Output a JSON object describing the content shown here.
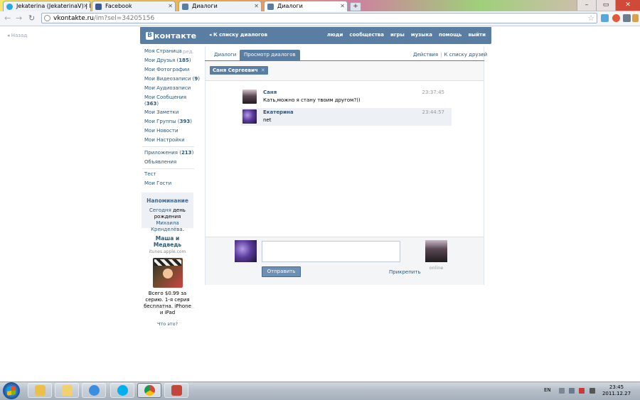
{
  "browser": {
    "tabs": [
      {
        "label": "Jekaterina (JekaterinaV) | Fo",
        "favicon": "skype-icon",
        "active": false
      },
      {
        "label": "Facebook",
        "favicon": "facebook-icon",
        "active": false
      },
      {
        "label": "Диалоги",
        "favicon": "vk-icon",
        "active": false
      },
      {
        "label": "Диалоги",
        "favicon": "vk-icon",
        "active": true
      }
    ],
    "url_host": "vkontakte.ru",
    "url_path": "/im?sel=34205156"
  },
  "vk": {
    "back_label": "Назад",
    "logo": {
      "letter": "B",
      "word": "контакте"
    },
    "to_list_label": "◂ К списку диалогов",
    "top_nav": [
      "люди",
      "сообщества",
      "игры",
      "музыка",
      "помощь",
      "выйти"
    ],
    "menu": [
      {
        "label": "Моя Страница",
        "count": ""
      },
      {
        "label": "Мои Друзья",
        "count": "185"
      },
      {
        "label": "Мои Фотографии",
        "count": ""
      },
      {
        "label": "Мои Видеозаписи",
        "count": "9"
      },
      {
        "label": "Мои Аудиозаписи",
        "count": ""
      },
      {
        "label": "Мои Сообщения",
        "count": "363"
      },
      {
        "label": "Мои Заметки",
        "count": ""
      },
      {
        "label": "Мои Группы",
        "count": "393"
      },
      {
        "label": "Мои Новости",
        "count": ""
      },
      {
        "label": "Мои Настройки",
        "count": ""
      },
      {
        "label": "Приложения",
        "count": "213"
      },
      {
        "label": "Объявления",
        "count": ""
      },
      {
        "label": "Тест",
        "count": ""
      },
      {
        "label": "Мои Гости",
        "count": ""
      }
    ],
    "edit_label": "ред.",
    "reminder": {
      "title": "Напоминание",
      "today": "Сегодня",
      "text": "день рождения",
      "person": "Михаила Кренделёва",
      "dot": "."
    },
    "ad": {
      "title": "Маша и Медведь",
      "source": "itunes.apple.com",
      "text": "Всего $0.99 за серию. 1-я серия бесплатна. iPhone и iPad",
      "what": "Что это?"
    },
    "tabs": {
      "dialogs": "Диалоги",
      "view": "Просмотр диалогов"
    },
    "actions": {
      "actions": "Действия",
      "sep": "|",
      "friends": "К списку друзей"
    },
    "peer_name": "Саня Сергеевич",
    "peer_close": "✕",
    "messages": [
      {
        "author": "Саня",
        "text": "Кать,можно я стану твоим другом?))",
        "time": "23:37:45"
      },
      {
        "author": "Екатерина",
        "text": "net",
        "time": "23:44:57"
      }
    ],
    "composer": {
      "send_label": "Отправить",
      "attach_label": "Прикрепить",
      "status": "online"
    }
  },
  "taskbar": {
    "language": "EN",
    "time": "23:45",
    "date": "2011.12.27"
  },
  "colors": {
    "vk_blue": "#597da3",
    "link": "#2b587a"
  }
}
